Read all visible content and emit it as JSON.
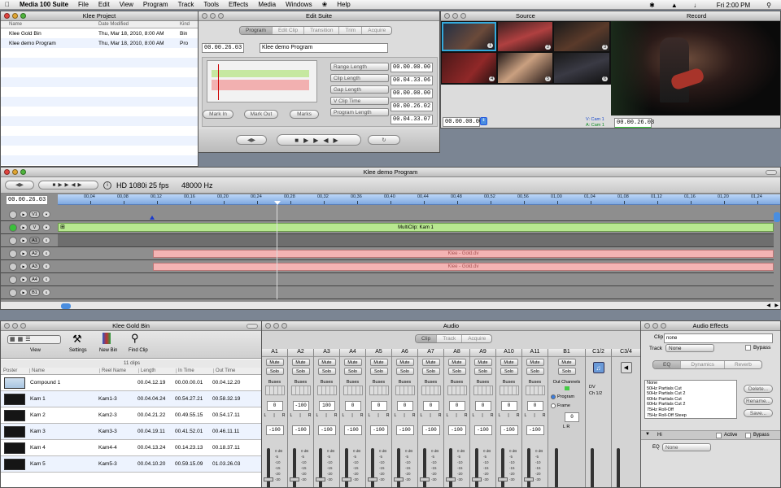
{
  "menubar": {
    "app": "Media 100 Suite",
    "items": [
      "File",
      "Edit",
      "View",
      "Program",
      "Track",
      "Tools",
      "Effects",
      "Media",
      "Windows",
      "Help"
    ],
    "time": "Fri 2:00 PM"
  },
  "project": {
    "title": "Klee Project",
    "columns": [
      "Name",
      "Date Modified",
      "Kind"
    ],
    "rows": [
      {
        "name": "Klee Gold Bin",
        "date": "Thu, Mar 18, 2010, 8:00 AM",
        "kind": "Bin"
      },
      {
        "name": "Klee demo Program",
        "date": "Thu, Mar 18, 2010, 8:00 AM",
        "kind": "Pro"
      }
    ]
  },
  "edit": {
    "title": "Edit Suite",
    "tabs": [
      "Program",
      "Edit Clip",
      "Transition",
      "Trim",
      "Acquire"
    ],
    "timecode": "00.00.26.03",
    "program_name": "Klee demo Program",
    "fields": [
      {
        "label": "Range Length",
        "value": "00.00.00.00"
      },
      {
        "label": "Clip Length",
        "value": "00.04.33.06"
      },
      {
        "label": "Gap Length",
        "value": "00.00.00.00"
      },
      {
        "label": "V Clip Time",
        "value": "00.00.26.02"
      },
      {
        "label": "Program Length",
        "value": "00.04.33.07"
      }
    ],
    "mark_in": "Mark In",
    "mark_out": "Mark Out",
    "marks": "Marks"
  },
  "source": {
    "title": "Source",
    "timecode": "00.00.00.00",
    "badges": [
      "1",
      "2",
      "3",
      "4",
      "5",
      "6"
    ]
  },
  "record": {
    "title": "Record",
    "v_label": "V: Cam 1",
    "a_label": "A: Cam 1",
    "timecode": "00.00.26.03"
  },
  "program": {
    "title": "Klee demo Program",
    "format": "HD 1080i 25 fps",
    "audio_rate": "48000 Hz",
    "timecode": "00.00.26.03",
    "ruler": [
      "00,04",
      "00,08",
      "00,12",
      "00,16",
      "00,20",
      "00,24",
      "00,28",
      "00,32",
      "00,36",
      "00,40",
      "00,44",
      "00,48",
      "00,52",
      "00,56",
      "01,00",
      "01,04",
      "01,08",
      "01,12",
      "01,16",
      "01,20",
      "01,24"
    ],
    "tracks": [
      "V1",
      "V",
      "A1",
      "A2",
      "A3",
      "A4",
      "B1"
    ],
    "multiclip": "MultiClip: Kam 1",
    "audio_clip": "Klee - Gold.dv"
  },
  "bin": {
    "title": "Klee Gold Bin",
    "tools": [
      "View",
      "Settings",
      "New Bin",
      "Find Clip"
    ],
    "count": "11 clips",
    "columns": [
      "Poster",
      "Name",
      "Reel Name",
      "Length",
      "In Time",
      "Out Time"
    ],
    "rows": [
      {
        "name": "Compound 1",
        "reel": "",
        "length": "00.04.12.19",
        "in": "00.00.00.01",
        "out": "00.04.12.20"
      },
      {
        "name": "Kam 1",
        "reel": "Kam1-3",
        "length": "00.04.04.24",
        "in": "00.54.27.21",
        "out": "00.58.32.19"
      },
      {
        "name": "Kam 2",
        "reel": "Kam2-3",
        "length": "00.04.21.22",
        "in": "00.49.55.15",
        "out": "00.54.17.11"
      },
      {
        "name": "Kam 3",
        "reel": "Kam3-3",
        "length": "00.04.19.11",
        "in": "00.41.52.01",
        "out": "00.46.11.11"
      },
      {
        "name": "Kam 4",
        "reel": "Kam4-4",
        "length": "00.04.13.24",
        "in": "00.14.23.13",
        "out": "00.18.37.11"
      },
      {
        "name": "Kam 5",
        "reel": "Kam5-3",
        "length": "00.04.10.20",
        "in": "00.59.15.09",
        "out": "01.03.26.03"
      }
    ]
  },
  "audio": {
    "title": "Audio",
    "tabs": [
      "Clip",
      "Track",
      "Acquire"
    ],
    "channels": [
      "A1",
      "A2",
      "A3",
      "A4",
      "A5",
      "A6",
      "A7",
      "A8",
      "A9",
      "A10",
      "A11"
    ],
    "mute": "Mute",
    "solo": "Solo",
    "buses": "Buses",
    "pan_values": [
      "0",
      "-100",
      "100",
      "0",
      "0",
      "0",
      "0",
      "0",
      "0",
      "0",
      "0"
    ],
    "gain": "-100",
    "b1": "B1",
    "out_channels": "Out Channels",
    "program": "Program",
    "frame": "Frame",
    "c12": "C1/2",
    "c34": "C3/4",
    "dv": "DV",
    "ch12": "Ch 1/2",
    "scale": [
      "0 dB",
      "-5",
      "-10",
      "-15",
      "-20",
      "-30"
    ]
  },
  "effects": {
    "title": "Audio Effects",
    "clip_label": "Clip",
    "clip_value": "none",
    "track_label": "Track",
    "track_value": "None",
    "bypass": "Bypass",
    "tabs": [
      "EQ",
      "Dynamics",
      "Reverb"
    ],
    "presets": [
      "None",
      "50Hz Partials Cut",
      "50Hz Partials Cut 2",
      "60Hz Partials Cut",
      "60Hz Partials Cut 2",
      "75Hz Roll-Off",
      "75Hz Roll-Off Steep"
    ],
    "delete": "Delete...",
    "rename": "Rename...",
    "save": "Save...",
    "hi": "Hi",
    "active": "Active",
    "eq_label": "EQ",
    "eq_value": "None"
  }
}
